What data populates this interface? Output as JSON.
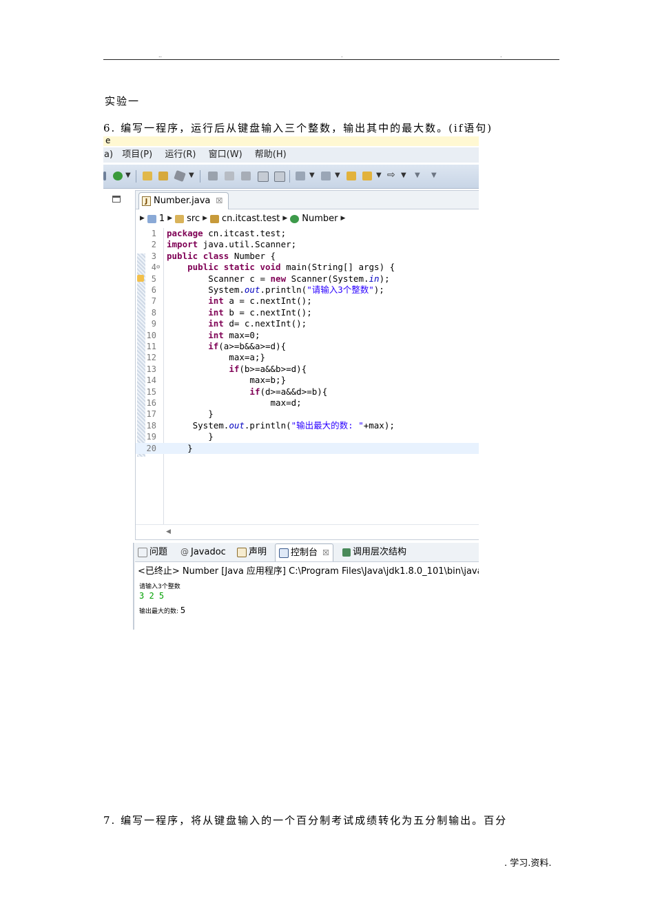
{
  "header": {
    "dots": [
      "..",
      ".",
      "."
    ]
  },
  "doc": {
    "heading": "实验一",
    "q6": "6. 编写一程序，运行后从键盘输入三个整数，输出其中的最大数。(if语句)",
    "q7": "7. 编写一程序，将从键盘输入的一个百分制考试成绩转化为五分制输出。百分",
    "footer": ". 学习.资料."
  },
  "ide": {
    "title_fragment": "e",
    "menu": [
      "a)",
      "项目(P)",
      "运行(R)",
      "窗口(W)",
      "帮助(H)"
    ],
    "editor_tab": {
      "label": "Number.java",
      "close": "☒"
    },
    "breadcrumb": [
      "1",
      "src",
      "cn.itcast.test",
      "Number"
    ],
    "code": [
      {
        "n": "1",
        "t": "package cn.itcast.test;"
      },
      {
        "n": "2",
        "t": "import java.util.Scanner;"
      },
      {
        "n": "3",
        "t": "public class Number {"
      },
      {
        "n": "4",
        "t": "    public static void main(String[] args) {"
      },
      {
        "n": "5",
        "t": "        Scanner c = new Scanner(System.in);"
      },
      {
        "n": "6",
        "t": "        System.out.println(\"请输入3个整数\");"
      },
      {
        "n": "7",
        "t": "        int a = c.nextInt();"
      },
      {
        "n": "8",
        "t": "        int b = c.nextInt();"
      },
      {
        "n": "9",
        "t": "        int d= c.nextInt();"
      },
      {
        "n": "10",
        "t": "        int max=0;"
      },
      {
        "n": "11",
        "t": "        if(a>=b&&a>=d){"
      },
      {
        "n": "12",
        "t": "            max=a;}"
      },
      {
        "n": "13",
        "t": "            if(b>=a&&b>=d){"
      },
      {
        "n": "14",
        "t": "                max=b;}"
      },
      {
        "n": "15",
        "t": "                if(d>=a&&d>=b){"
      },
      {
        "n": "16",
        "t": "                    max=d;"
      },
      {
        "n": "17",
        "t": "        }"
      },
      {
        "n": "18",
        "t": "     System.out.println(\"输出最大的数: \"+max);"
      },
      {
        "n": "19",
        "t": "        }"
      },
      {
        "n": "20",
        "t": "    }"
      }
    ],
    "bottom_tabs": [
      "问题",
      "Javadoc",
      "声明",
      "控制台",
      "调用层次结构"
    ],
    "console": {
      "status": "<已终止> Number [Java 应用程序] C:\\Program Files\\Java\\jdk1.8.0_101\\bin\\java",
      "prompt": "请输入3个整数",
      "input": "3 2 5",
      "result_label": "输出最大的数: ",
      "result_value": "5"
    }
  }
}
